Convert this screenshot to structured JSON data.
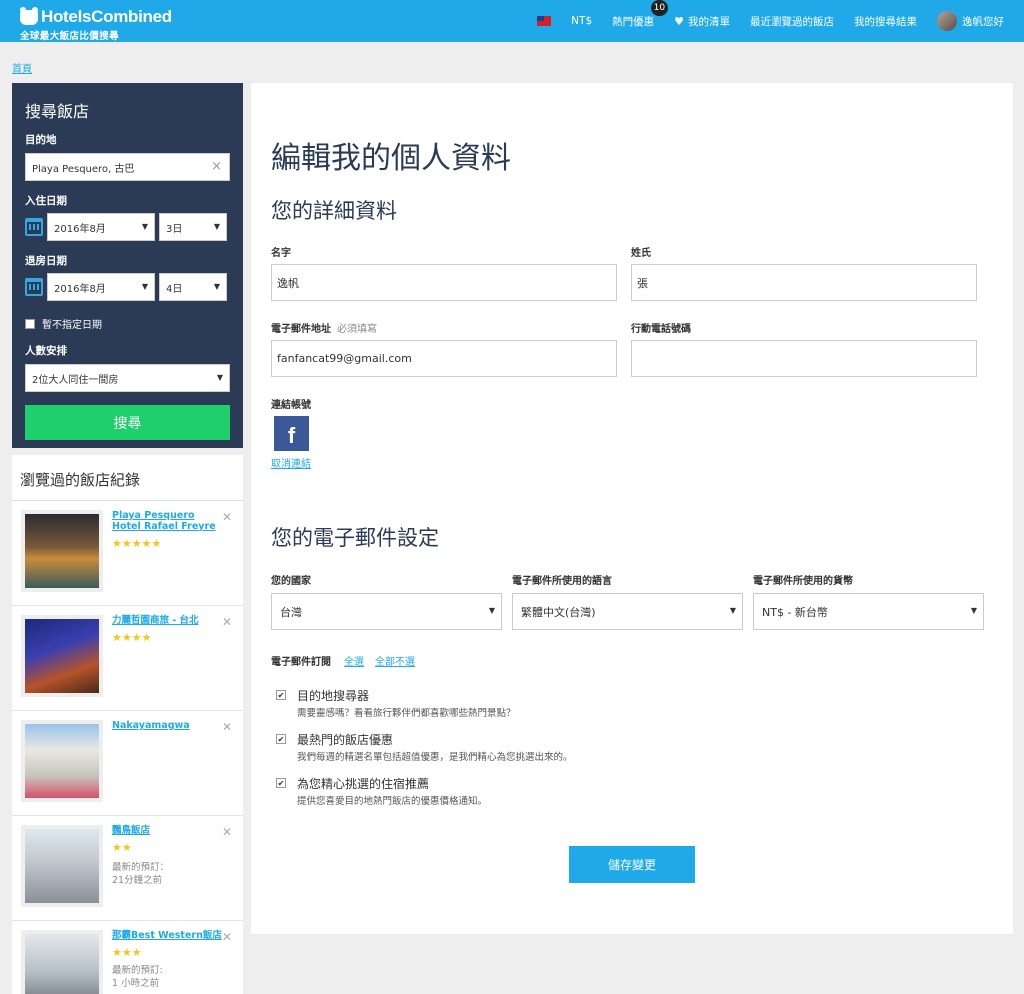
{
  "header": {
    "logo_text": "HotelsCombined",
    "logo_tagline": "全球最大飯店比價搜尋",
    "currency": "NT$",
    "deals_label": "熱門優惠",
    "deals_count": "10",
    "wishlist_label": "我的清單",
    "recent_label": "最近瀏覽過的飯店",
    "results_label": "我的搜尋結果",
    "user_label": "逸帆您好"
  },
  "breadcrumb": {
    "home": "首頁"
  },
  "search": {
    "title": "搜尋飯店",
    "destination_label": "目的地",
    "destination_value": "Playa Pesquero, 古巴",
    "checkin_label": "入住日期",
    "checkin_month": "2016年8月",
    "checkin_day": "3日",
    "checkout_label": "退房日期",
    "checkout_month": "2016年8月",
    "checkout_day": "4日",
    "no_date_label": "暫不指定日期",
    "guests_label": "人數安排",
    "guests_value": "2位大人同住一間房",
    "search_button": "搜尋"
  },
  "recent": {
    "title": "瀏覽過的飯店紀錄",
    "items": [
      {
        "name": "Playa Pesquero Hotel Rafael Freyre",
        "stars": "★★★★★",
        "meta1": "",
        "meta2": ""
      },
      {
        "name": "力麗哲園商旅 - 台北",
        "stars": "★★★★",
        "meta1": "",
        "meta2": ""
      },
      {
        "name": "Nakayamagwa",
        "stars": "",
        "meta1": "",
        "meta2": ""
      },
      {
        "name": "鸚鳥飯店",
        "stars": "★★",
        "meta1": "最新的預訂：",
        "meta2": "21分鐘之前"
      },
      {
        "name": "那霸Best Western飯店",
        "stars": "★★★",
        "meta1": "最新的預訂:",
        "meta2": "1 小時之前"
      }
    ]
  },
  "profile": {
    "page_title": "編輯我的個人資料",
    "details_heading": "您的詳細資料",
    "first_name_label": "名字",
    "first_name_value": "逸帆",
    "last_name_label": "姓氏",
    "last_name_value": "張",
    "email_label": "電子郵件地址",
    "email_required": "必須填寫",
    "email_value": "fanfancat99@gmail.com",
    "phone_label": "行動電話號碼",
    "phone_value": "",
    "linked_label": "連結帳號",
    "facebook_glyph": "f",
    "unlink_label": "取消連結",
    "email_settings_heading": "您的電子郵件設定",
    "country_label": "您的國家",
    "country_value": "台灣",
    "language_label": "電子郵件所使用的語言",
    "language_value": "繁體中文(台灣)",
    "currency_label": "電子郵件所使用的貨幣",
    "currency_value": "NT$ - 新台幣",
    "subscription_label": "電子郵件訂閱",
    "select_all": "全選",
    "select_none": "全部不選",
    "prefs": [
      {
        "title": "目的地搜尋器",
        "desc": "需要靈感嗎？看看旅行夥伴們都喜歡哪些熱門景點？"
      },
      {
        "title": "最熱門的飯店優惠",
        "desc": "我們每週的精選名單包括超值優惠，是我們精心為您挑選出來的。"
      },
      {
        "title": "為您精心挑選的住宿推薦",
        "desc": "提供您喜愛目的地熱門飯店的優惠價格通知。"
      }
    ],
    "save_button": "儲存變更"
  }
}
